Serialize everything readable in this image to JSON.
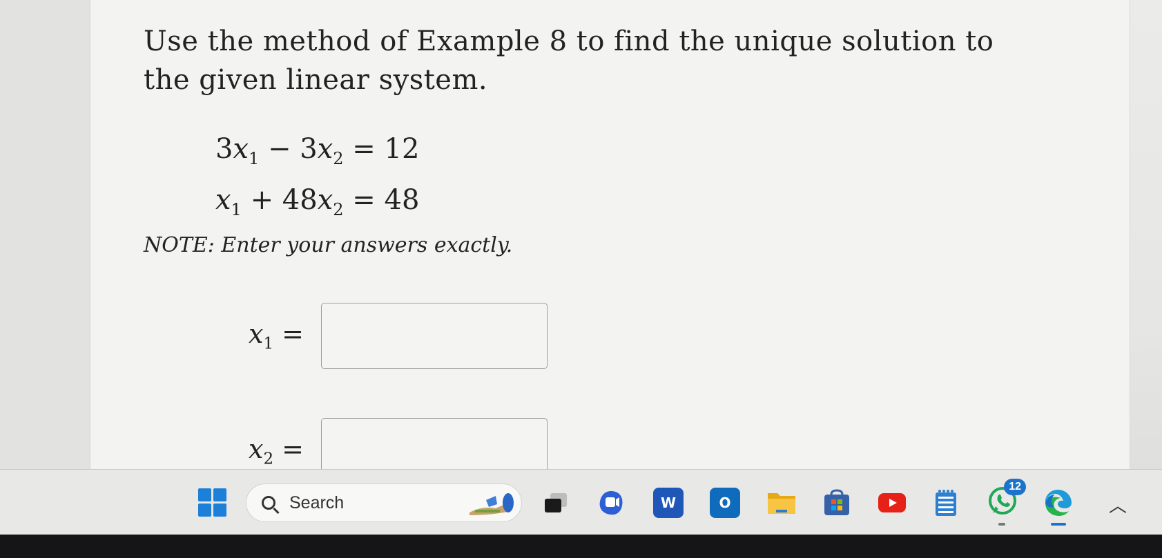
{
  "question": {
    "text": "Use the method of Example 8 to find the unique solution to the given linear system.",
    "equations": [
      {
        "c1": "3",
        "v1": "x",
        "s1": "1",
        "op": "−",
        "c2": "3",
        "v2": "x",
        "s2": "2",
        "rhs": "= 12"
      },
      {
        "c1": "",
        "v1": "x",
        "s1": "1",
        "op": "+",
        "c2": "48",
        "v2": "x",
        "s2": "2",
        "rhs": "= 48"
      }
    ],
    "note": "NOTE: Enter your answers exactly."
  },
  "answers": [
    {
      "var": "x",
      "sub": "1",
      "eq": " =",
      "value": ""
    },
    {
      "var": "x",
      "sub": "2",
      "eq": " =",
      "value": ""
    }
  ],
  "taskbar": {
    "search_label": "Search",
    "whatsapp_badge": "12",
    "icons": [
      "windows-start-icon",
      "search-icon",
      "widget-icon",
      "task-view-icon",
      "copilot-icon",
      "word-icon",
      "outlook-icon",
      "file-explorer-icon",
      "microsoft-store-icon",
      "youtube-icon",
      "notepad-icon",
      "whatsapp-icon",
      "edge-icon",
      "chevron-up-icon"
    ],
    "word_letter": "W",
    "outlook_letter": "O"
  },
  "colors": {
    "accent_blue": "#1c7fd8",
    "panel_bg": "#f3f3f1"
  }
}
